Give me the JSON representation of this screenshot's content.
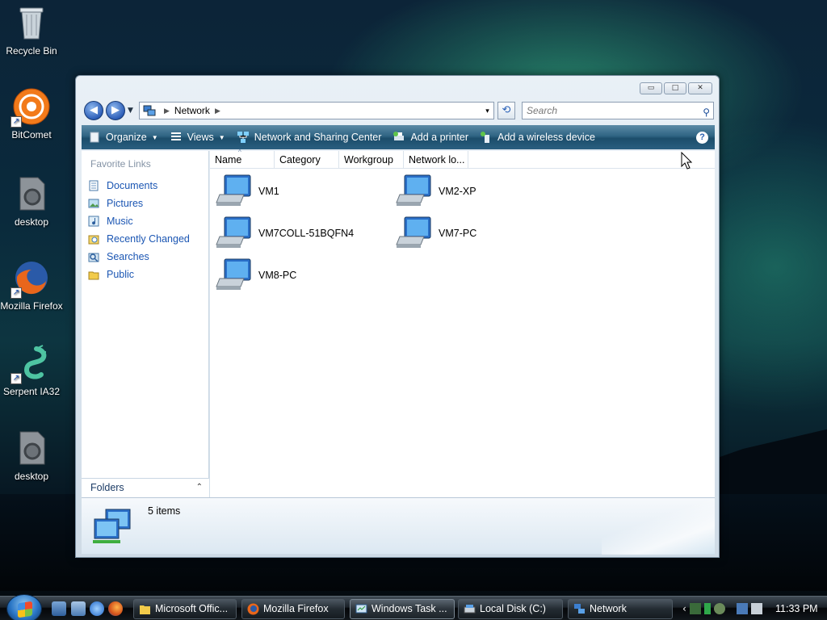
{
  "desktop": {
    "icons": [
      {
        "label": "Recycle Bin",
        "icon": "recycle-bin-icon"
      },
      {
        "label": "BitComet",
        "icon": "bitcomet-icon"
      },
      {
        "label": "desktop",
        "icon": "desktop-shortcut-icon"
      },
      {
        "label": "Mozilla Firefox",
        "icon": "firefox-icon"
      },
      {
        "label": "Serpent IA32",
        "icon": "serpent-icon"
      },
      {
        "label": "desktop",
        "icon": "desktop-shortcut-icon"
      }
    ]
  },
  "window": {
    "caption_buttons": {
      "minimize": "▭",
      "maximize": "□",
      "close": "✕"
    },
    "address": {
      "crumb": "Network",
      "dropdown_glyph": "▾"
    },
    "search": {
      "placeholder": "Search"
    },
    "toolbar": {
      "organize": "Organize",
      "views": "Views",
      "network_center": "Network and Sharing Center",
      "add_printer": "Add a printer",
      "add_wireless": "Add a wireless device",
      "help": "?"
    },
    "nav": {
      "header": "Favorite Links",
      "links": [
        "Documents",
        "Pictures",
        "Music",
        "Recently Changed",
        "Searches",
        "Public"
      ],
      "folders": "Folders"
    },
    "columns": [
      "Name",
      "Category",
      "Workgroup",
      "Network lo..."
    ],
    "items": [
      "VM1",
      "VM2-XP",
      "VM7COLL-51BQFN4",
      "VM7-PC",
      "VM8-PC"
    ],
    "status": "5 items"
  },
  "taskbar": {
    "buttons": [
      "Microsoft Offic...",
      "Mozilla Firefox",
      "Windows Task ...",
      "Local Disk (C:)",
      "Network"
    ],
    "clock": "11:33 PM",
    "tray_chevron": "‹"
  },
  "colors": {
    "accent": "#1b56b3",
    "cmdbar": "#2f6483",
    "taskbar": "#1a2128"
  }
}
